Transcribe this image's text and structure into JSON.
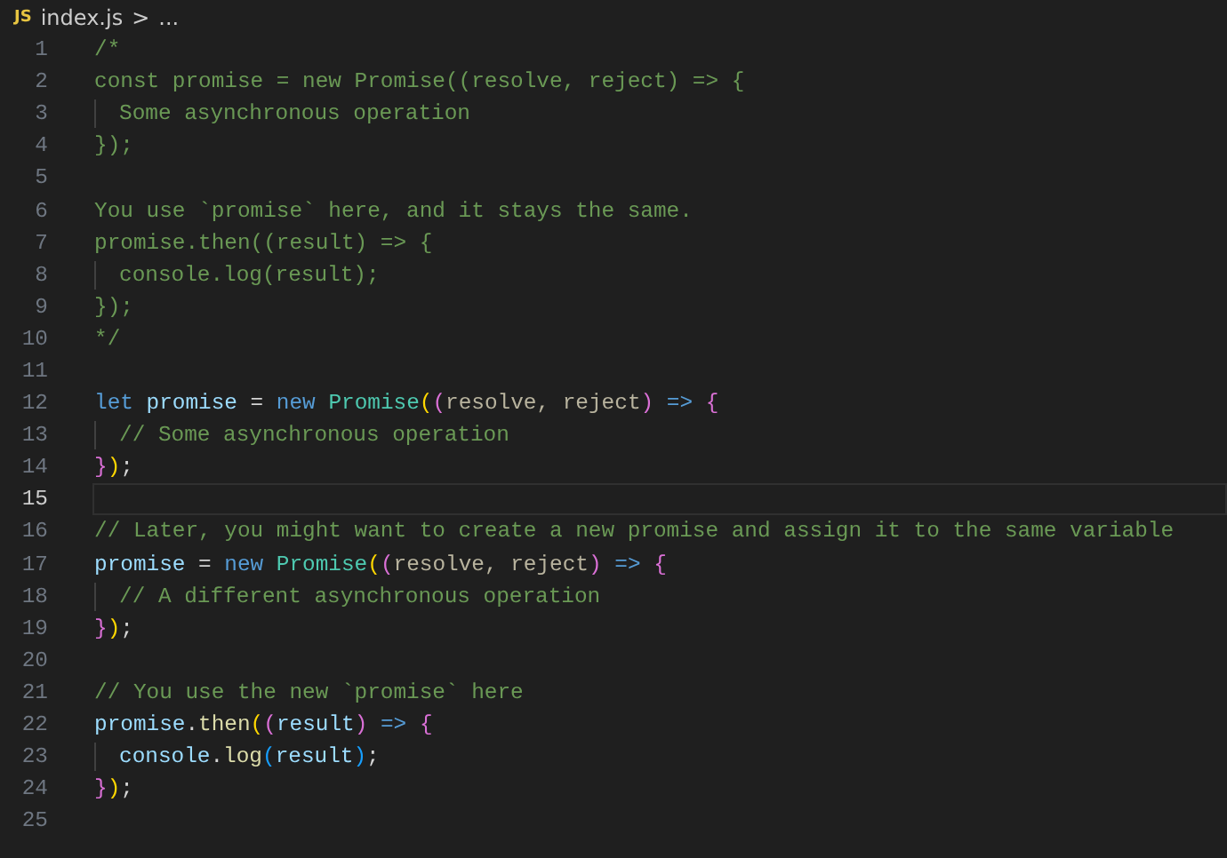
{
  "breadcrumb": {
    "file_icon": "JS",
    "file": "index.js",
    "separator": ">",
    "rest": "..."
  },
  "lines": [
    {
      "number": "1",
      "selected": false,
      "indented": false,
      "tokens": [
        {
          "text": "/*",
          "kind": "comment"
        }
      ]
    },
    {
      "number": "2",
      "selected": false,
      "indented": false,
      "tokens": [
        {
          "text": "const promise = new Promise((resolve, reject) => {",
          "kind": "comment"
        }
      ]
    },
    {
      "number": "3",
      "selected": false,
      "indented": true,
      "tokens": [
        {
          "text": "Some asynchronous operation",
          "kind": "comment"
        }
      ]
    },
    {
      "number": "4",
      "selected": false,
      "indented": false,
      "tokens": [
        {
          "text": "});",
          "kind": "comment"
        }
      ]
    },
    {
      "number": "5",
      "selected": false,
      "indented": false
    },
    {
      "number": "6",
      "selected": false,
      "indented": false,
      "tokens": [
        {
          "text": "You use `promise` here, and it stays the same.",
          "kind": "comment"
        }
      ]
    },
    {
      "number": "7",
      "selected": false,
      "indented": false,
      "tokens": [
        {
          "text": "promise.then((result) => {",
          "kind": "comment"
        }
      ]
    },
    {
      "number": "8",
      "selected": false,
      "indented": true,
      "tokens": [
        {
          "text": "console.log(result);",
          "kind": "comment"
        }
      ]
    },
    {
      "number": "9",
      "selected": false,
      "indented": false,
      "tokens": [
        {
          "text": "});",
          "kind": "comment"
        }
      ]
    },
    {
      "number": "10",
      "selected": false,
      "indented": false,
      "tokens": [
        {
          "text": "*/",
          "kind": "comment"
        }
      ]
    },
    {
      "number": "11",
      "selected": false,
      "indented": false
    },
    {
      "number": "12",
      "selected": false,
      "indented": false,
      "tokens": [
        {
          "text": "let",
          "kind": "keyword"
        },
        {
          "text": " promise",
          "kind": "variable"
        },
        {
          "text": " = ",
          "kind": "plain"
        },
        {
          "text": "new",
          "kind": "keyword"
        },
        {
          "text": " Promise",
          "kind": "class"
        },
        {
          "text": "(",
          "kind": "bracket1"
        },
        {
          "text": "(",
          "kind": "bracket2"
        },
        {
          "text": "resolve, reject",
          "kind": "unused"
        },
        {
          "text": ")",
          "kind": "bracket2"
        },
        {
          "text": " => ",
          "kind": "keyword"
        },
        {
          "text": "{",
          "kind": "bracket2"
        }
      ]
    },
    {
      "number": "13",
      "selected": false,
      "indented": true,
      "tokens": [
        {
          "text": "// Some asynchronous operation",
          "kind": "comment"
        }
      ]
    },
    {
      "number": "14",
      "selected": false,
      "indented": false,
      "tokens": [
        {
          "text": "}",
          "kind": "bracket2"
        },
        {
          "text": ")",
          "kind": "bracket1"
        },
        {
          "text": ";",
          "kind": "plain"
        }
      ]
    },
    {
      "number": "15",
      "selected": true,
      "indented": false
    },
    {
      "number": "16",
      "selected": false,
      "indented": false,
      "tokens": [
        {
          "text": "// Later, you might want to create a new promise and assign it to the same variable",
          "kind": "comment"
        }
      ]
    },
    {
      "number": "17",
      "selected": false,
      "indented": false,
      "tokens": [
        {
          "text": "promise",
          "kind": "variable"
        },
        {
          "text": " = ",
          "kind": "plain"
        },
        {
          "text": "new",
          "kind": "keyword"
        },
        {
          "text": " Promise",
          "kind": "class"
        },
        {
          "text": "(",
          "kind": "bracket1"
        },
        {
          "text": "(",
          "kind": "bracket2"
        },
        {
          "text": "resolve, reject",
          "kind": "unused"
        },
        {
          "text": ")",
          "kind": "bracket2"
        },
        {
          "text": " => ",
          "kind": "keyword"
        },
        {
          "text": "{",
          "kind": "bracket2"
        }
      ]
    },
    {
      "number": "18",
      "selected": false,
      "indented": true,
      "tokens": [
        {
          "text": "// A different asynchronous operation",
          "kind": "comment"
        }
      ]
    },
    {
      "number": "19",
      "selected": false,
      "indented": false,
      "tokens": [
        {
          "text": "}",
          "kind": "bracket2"
        },
        {
          "text": ")",
          "kind": "bracket1"
        },
        {
          "text": ";",
          "kind": "plain"
        }
      ]
    },
    {
      "number": "20",
      "selected": false,
      "indented": false
    },
    {
      "number": "21",
      "selected": false,
      "indented": false,
      "tokens": [
        {
          "text": "// You use the new `promise` here",
          "kind": "comment"
        }
      ]
    },
    {
      "number": "22",
      "selected": false,
      "indented": false,
      "tokens": [
        {
          "text": "promise",
          "kind": "variable"
        },
        {
          "text": ".",
          "kind": "plain"
        },
        {
          "text": "then",
          "kind": "function"
        },
        {
          "text": "(",
          "kind": "bracket1"
        },
        {
          "text": "(",
          "kind": "bracket2"
        },
        {
          "text": "result",
          "kind": "variable"
        },
        {
          "text": ")",
          "kind": "bracket2"
        },
        {
          "text": " => ",
          "kind": "keyword"
        },
        {
          "text": "{",
          "kind": "bracket2"
        }
      ]
    },
    {
      "number": "23",
      "selected": false,
      "indented": true,
      "tokens": [
        {
          "text": "console",
          "kind": "variable"
        },
        {
          "text": ".",
          "kind": "plain"
        },
        {
          "text": "log",
          "kind": "function"
        },
        {
          "text": "(",
          "kind": "bracket3"
        },
        {
          "text": "result",
          "kind": "variable"
        },
        {
          "text": ")",
          "kind": "bracket3"
        },
        {
          "text": ";",
          "kind": "plain"
        }
      ]
    },
    {
      "number": "24",
      "selected": false,
      "indented": false,
      "tokens": [
        {
          "text": "}",
          "kind": "bracket2"
        },
        {
          "text": ")",
          "kind": "bracket1"
        },
        {
          "text": ";",
          "kind": "plain"
        }
      ]
    },
    {
      "number": "25",
      "selected": false,
      "indented": false
    }
  ]
}
